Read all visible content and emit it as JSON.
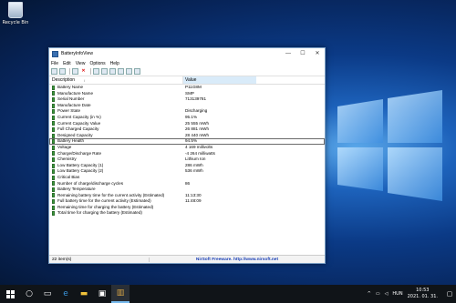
{
  "desktop": {
    "icons": [
      {
        "label": "Recycle Bin",
        "icon": "recycle-bin-icon"
      }
    ]
  },
  "window": {
    "title": "BatteryInfoView",
    "controls": {
      "minimize": "—",
      "maximize": "☐",
      "close": "✕"
    },
    "menu": [
      "File",
      "Edit",
      "View",
      "Options",
      "Help"
    ],
    "columns": {
      "description": "Description",
      "value": "Value"
    },
    "rows": [
      {
        "description": "Battery Name",
        "value": "P11G8M"
      },
      {
        "description": "Manufacture Name",
        "value": "SMP"
      },
      {
        "description": "Serial Number",
        "value": "713139781"
      },
      {
        "description": "Manufacture Date",
        "value": ""
      },
      {
        "description": "Power State",
        "value": "Discharging"
      },
      {
        "description": "Current Capacity (in %)",
        "value": "95.1%"
      },
      {
        "description": "Current Capacity Value",
        "value": "25 555 mWh"
      },
      {
        "description": "Full Charged Capacity",
        "value": "26 881 mWh"
      },
      {
        "description": "Designed Capacity",
        "value": "28 440 mWh"
      },
      {
        "description": "Battery Health",
        "value": "94.5%"
      },
      {
        "description": "Voltage",
        "value": "4 169 millivolts"
      },
      {
        "description": "Charge/Discharge Rate",
        "value": "-4 264 milliwatts"
      },
      {
        "description": "Chemistry",
        "value": "Lithium Ion"
      },
      {
        "description": "Low Battery Capacity (1)",
        "value": "286 mWh"
      },
      {
        "description": "Low Battery Capacity (2)",
        "value": "536 mWh"
      },
      {
        "description": "Critical Bias",
        "value": ""
      },
      {
        "description": "Number of charge/discharge cycles",
        "value": "86"
      },
      {
        "description": "Battery Temperature",
        "value": ""
      },
      {
        "description": "Remaining battery time for the current activity (Estimated)",
        "value": "11:13:30"
      },
      {
        "description": "Full battery time for the current activity (Estimated)",
        "value": "11:48:09"
      },
      {
        "description": "Remaining time for charging the battery (Estimated)",
        "value": ""
      },
      {
        "description": "Total time for charging the battery (Estimated)",
        "value": ""
      }
    ],
    "selected_row": "Battery Health",
    "status": {
      "count": "22 item(s)",
      "credit": "NirSoft Freeware.  http://www.nirsoft.net"
    }
  },
  "taskbar": {
    "items": [
      "start-icon",
      "search-icon",
      "task-view-icon",
      "edge-icon",
      "file-explorer-icon",
      "store-icon",
      "batteryinfoview-icon"
    ],
    "tray": {
      "language": "HUN",
      "time": "10:53",
      "date": "2021. 01. 31."
    }
  },
  "colors": {
    "desktop": "#0b3a86",
    "taskbar": "#101418",
    "header_selected": "#d9ebf9",
    "battery_icon": "#3c9a3c",
    "link": "#1a3fb5"
  }
}
